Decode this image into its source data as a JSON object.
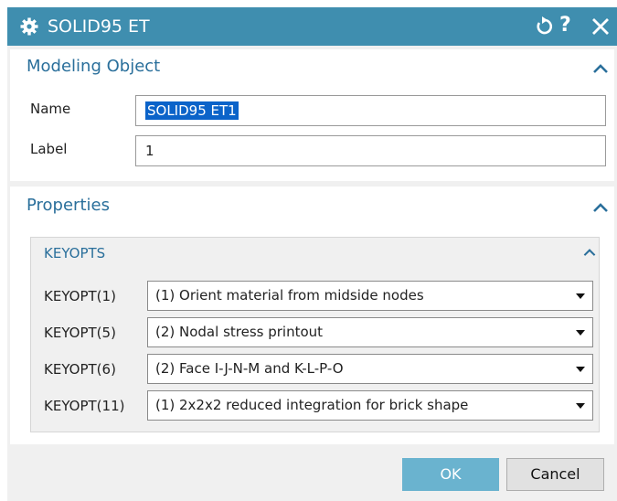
{
  "window": {
    "title": "SOLID95 ET",
    "help_label": "?"
  },
  "modeling_object": {
    "title": "Modeling Object",
    "name_label": "Name",
    "name_value": "SOLID95 ET1",
    "label_label": "Label",
    "label_value": "1"
  },
  "properties": {
    "title": "Properties",
    "keyopts": {
      "title": "KEYOPTS",
      "rows": [
        {
          "label": "KEYOPT(1)",
          "value": "(1) Orient material from midside nodes"
        },
        {
          "label": "KEYOPT(5)",
          "value": "(2) Nodal stress printout"
        },
        {
          "label": "KEYOPT(6)",
          "value": "(2) Face I-J-N-M and K-L-P-O"
        },
        {
          "label": "KEYOPT(11)",
          "value": "(1) 2x2x2 reduced integration for brick shape"
        }
      ]
    }
  },
  "buttons": {
    "ok": "OK",
    "cancel": "Cancel"
  },
  "colors": {
    "titlebar": "#3f8eaf",
    "accent_text": "#2a6f9b",
    "ok_button": "#6ab3cf",
    "selection": "#0b63c9"
  }
}
